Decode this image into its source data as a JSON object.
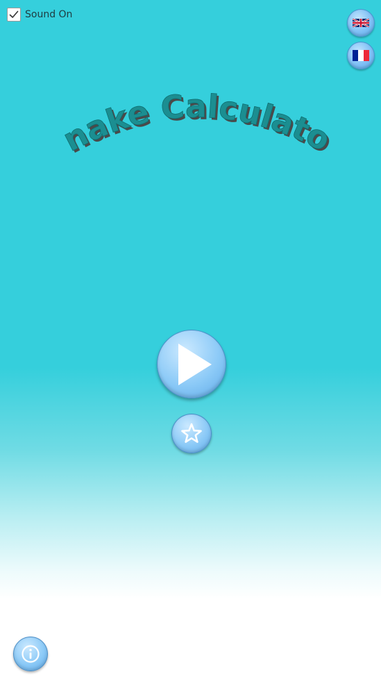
{
  "sound": {
    "label": "Sound On",
    "checked": true
  },
  "languages": [
    {
      "code": "en",
      "icon": "uk-flag-icon"
    },
    {
      "code": "fr",
      "icon": "france-flag-icon"
    }
  ],
  "title": "Snake Calculator",
  "buttons": {
    "play_icon": "play-icon",
    "star_icon": "star-icon",
    "info_icon": "info-icon"
  },
  "colors": {
    "background_top": "#35cfdc",
    "background_bottom": "#ffffff",
    "title_fill": "#1b8e91",
    "title_shadow": "#4a4a4a",
    "button_blue": "#8ccaf7"
  }
}
